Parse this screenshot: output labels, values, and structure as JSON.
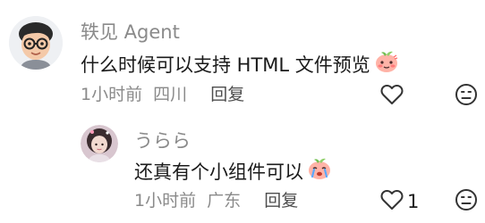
{
  "comments": [
    {
      "username": "轶见 Agent",
      "text": "什么时候可以支持 HTML 文件预览",
      "emoji_icon": "shy-peach-emoji-icon",
      "time": "1小时前",
      "location": "四川",
      "reply_label": "回复",
      "like_count": ""
    }
  ],
  "replies": [
    {
      "username": "うらら",
      "text": "还真有个小组件可以",
      "emoji_icon": "crying-peach-emoji-icon",
      "time": "1小时前",
      "location": "广东",
      "reply_label": "回复",
      "like_count": "1"
    }
  ],
  "colors": {
    "meta": "#8a8a8a",
    "text": "#1a1a1a",
    "reply": "#4d4d4d"
  }
}
